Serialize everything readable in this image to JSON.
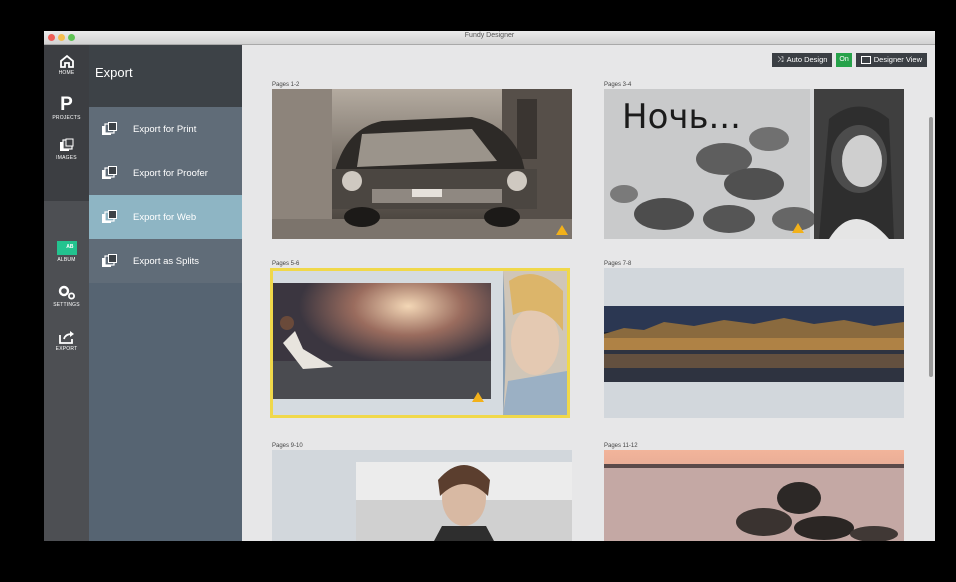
{
  "window": {
    "title": "Fundy Designer"
  },
  "rail": {
    "home": "HOME",
    "projects": "PROJECTS",
    "images": "IMAGES",
    "album": "ALBUM",
    "settings": "SETTINGS",
    "export": "EXPORT"
  },
  "menu": {
    "title": "Export",
    "items": [
      {
        "label": "Export for Print",
        "active": false
      },
      {
        "label": "Export for Proofer",
        "active": false
      },
      {
        "label": "Export for Web",
        "active": true
      },
      {
        "label": "Export as Splits",
        "active": false
      }
    ]
  },
  "toolbar": {
    "auto_design": "Auto Design",
    "auto_design_state": "On",
    "designer_view": "Designer View"
  },
  "spreads": [
    {
      "label": "Pages 1-2"
    },
    {
      "label": "Pages 3-4",
      "overlay_text": "Ночь..."
    },
    {
      "label": "Pages 5-6",
      "selected": true
    },
    {
      "label": "Pages 7-8"
    },
    {
      "label": "Pages 9-10"
    },
    {
      "label": "Pages 11-12"
    }
  ],
  "colors": {
    "accent_selected": "#f0d84a",
    "menu_active": "#8eb5c4",
    "warning": "#f2b11a",
    "toggle_on": "#27a24a"
  }
}
